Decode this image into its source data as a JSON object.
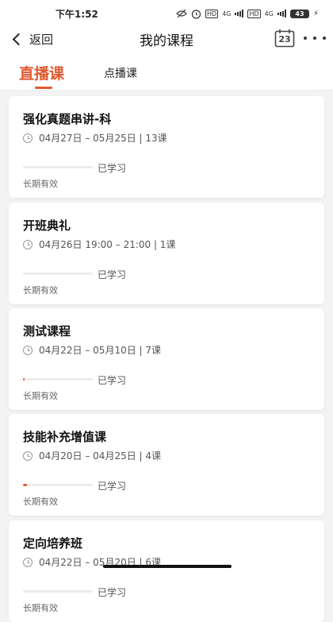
{
  "status_bar": {
    "time": "下午1:52",
    "network_1": "4G",
    "network_2": "4G",
    "hd_1": "HD",
    "hd_2": "HD",
    "battery": "43"
  },
  "header": {
    "back_label": "返回",
    "title": "我的课程",
    "calendar_day": "23"
  },
  "tabs": {
    "live": "直播课",
    "vod": "点播课",
    "active": "live"
  },
  "accent_color": "#e2582e",
  "courses": [
    {
      "title": "强化真题串讲-科",
      "schedule": "04月27日 – 05月25日 | 13课",
      "progress": 0,
      "progress_label": "已学习",
      "validity": "长期有效"
    },
    {
      "title": "开班典礼",
      "schedule": "04月26日 19:00 –  21:00 | 1课",
      "progress": 0,
      "progress_label": "已学习",
      "validity": "长期有效"
    },
    {
      "title": "测试课程",
      "schedule": "04月22日 – 05月10日 | 7课",
      "progress": 0.02,
      "progress_label": "已学习",
      "validity": "长期有效"
    },
    {
      "title": "技能补充增值课",
      "schedule": "04月20日 – 04月25日 | 4课",
      "progress": 0.06,
      "progress_label": "已学习",
      "validity": "长期有效"
    },
    {
      "title": "定向培养班",
      "schedule": "04月22日 – 05月20日 | 6课",
      "progress": 0,
      "progress_label": "已学习",
      "validity": "长期有效"
    }
  ]
}
